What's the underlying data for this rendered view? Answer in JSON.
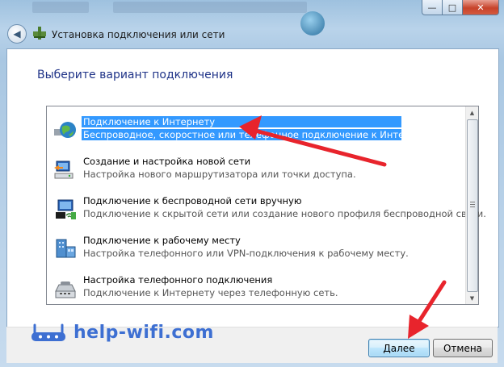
{
  "window": {
    "title": "Установка подключения или сети",
    "controls": {
      "minimize": "—",
      "maximize": "□",
      "close": "✕"
    }
  },
  "header": {
    "back_icon": "back-arrow-icon",
    "wizard_icon": "network-setup-icon"
  },
  "main": {
    "heading": "Выберите вариант подключения",
    "options": [
      {
        "title": "Подключение к Интернету",
        "desc": "Беспроводное, скоростное или телефонное подключение к Интернету.",
        "icon": "globe-icon",
        "selected": true
      },
      {
        "title": "Создание и настройка новой сети",
        "desc": "Настройка нового маршрутизатора или точки доступа.",
        "icon": "router-icon",
        "selected": false
      },
      {
        "title": "Подключение к беспроводной сети вручную",
        "desc": "Подключение к скрытой сети или создание нового профиля беспроводной связи.",
        "icon": "wireless-network-icon",
        "selected": false
      },
      {
        "title": "Подключение к рабочему месту",
        "desc": "Настройка телефонного или VPN-подключения к рабочему месту.",
        "icon": "workplace-icon",
        "selected": false
      },
      {
        "title": "Настройка телефонного подключения",
        "desc": "Подключение к Интернету через телефонную сеть.",
        "icon": "modem-icon",
        "selected": false
      }
    ]
  },
  "buttons": {
    "next": "Далее",
    "cancel": "Отмена"
  },
  "watermark": {
    "text": "help-wifi.com"
  },
  "colors": {
    "selection": "#3399ff",
    "heading": "#1e3287",
    "annotation_arrow": "#e8242c",
    "watermark": "#3d6fd2"
  }
}
